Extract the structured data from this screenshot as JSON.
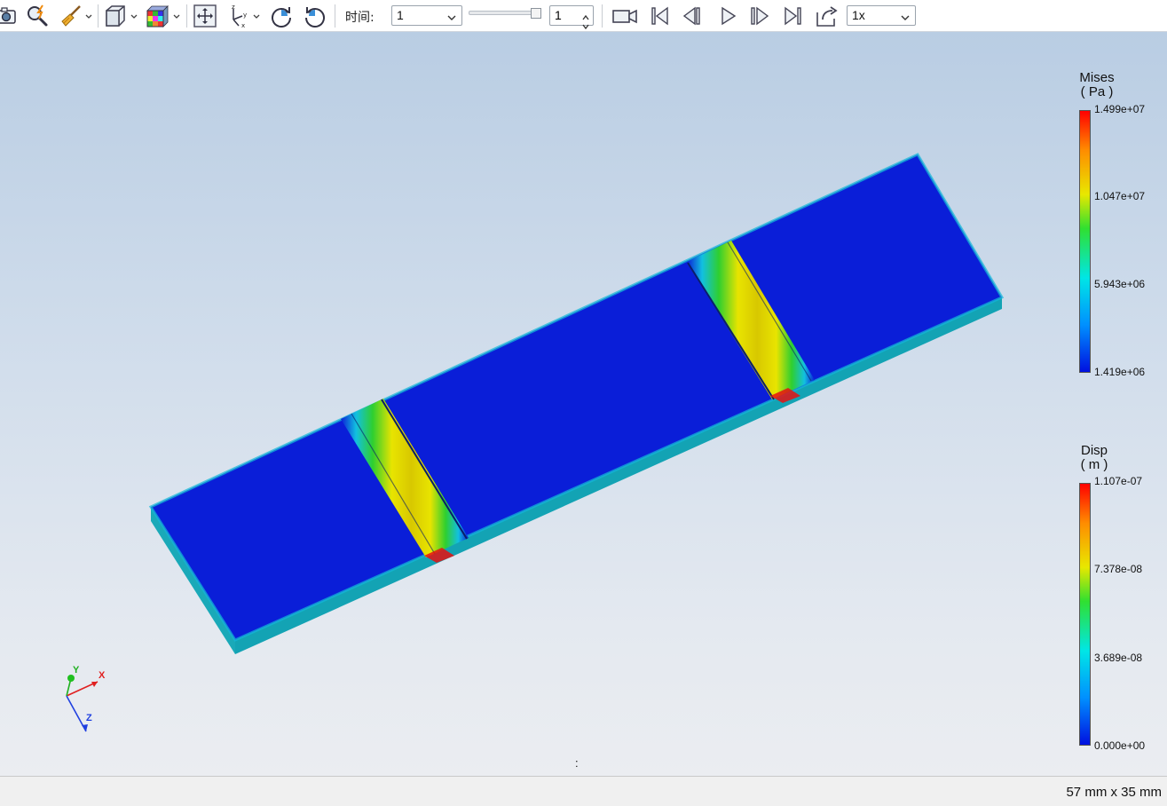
{
  "toolbar": {
    "icons": [
      "camera-icon",
      "zoom-lightning-icon",
      "broom-icon",
      "cube-view-icon",
      "colored-cube-icon",
      "fit-view-icon",
      "axis-xyz-icon",
      "rotate-cw-icon",
      "rotate-ccw-icon"
    ],
    "time_label": "时间:",
    "time_select_value": "1",
    "spin_value": "1",
    "playback_icons": [
      "record-camera-icon",
      "skip-first-icon",
      "step-back-icon",
      "play-icon",
      "step-forward-icon",
      "skip-last-icon",
      "export-icon"
    ],
    "speed_value": "1x"
  },
  "legend_mises": {
    "title_line1": "Mises",
    "title_line2": "( Pa )",
    "ticks": [
      "1.499e+07",
      "1.047e+07",
      "5.943e+06",
      "1.419e+06"
    ]
  },
  "legend_disp": {
    "title_line1": "Disp",
    "title_line2": "( m )",
    "ticks": [
      "1.107e-07",
      "7.378e-08",
      "3.689e-08",
      "0.000e+00"
    ]
  },
  "axes": {
    "y": "Y",
    "x": "X",
    "z": "Z"
  },
  "center_text": ":",
  "status": {
    "size_text": "57 mm x 35 mm"
  },
  "colors": {
    "deep_blue": "#0a1ed8",
    "hot_red": "#e81010",
    "yellow": "#e8e400",
    "cyan": "#12c0e0",
    "green": "#2fcf2f"
  }
}
